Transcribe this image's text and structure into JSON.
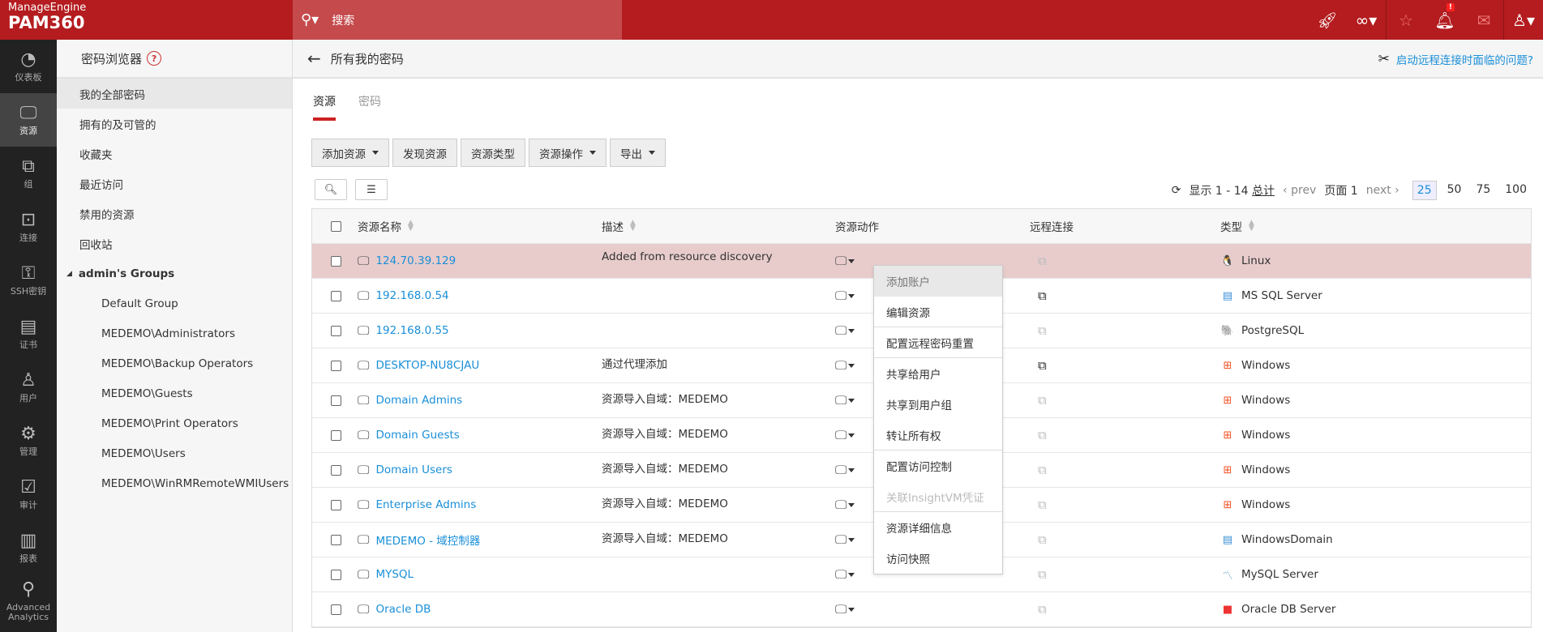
{
  "header": {
    "brand": "ManageEngine",
    "product": "PAM360",
    "search_placeholder": "搜索",
    "alert_badge": "!"
  },
  "iconbar": [
    {
      "label": "仪表板",
      "icon": "dashboard-icon",
      "glyph": "◔"
    },
    {
      "label": "资源",
      "icon": "monitor-icon",
      "glyph": "🖵",
      "active": true
    },
    {
      "label": "组",
      "icon": "group-icon",
      "glyph": "⧉"
    },
    {
      "label": "连接",
      "icon": "connection-icon",
      "glyph": "⊡"
    },
    {
      "label": "SSH密钥",
      "icon": "ssh-key-icon",
      "glyph": "⚿"
    },
    {
      "label": "证书",
      "icon": "certificate-icon",
      "glyph": "▤"
    },
    {
      "label": "用户",
      "icon": "user-icon",
      "glyph": "♙"
    },
    {
      "label": "管理",
      "icon": "gear-icon",
      "glyph": "⚙"
    },
    {
      "label": "审计",
      "icon": "clipboard-icon",
      "glyph": "☑"
    },
    {
      "label": "报表",
      "icon": "bar-chart-icon",
      "glyph": "▥"
    },
    {
      "label": "Advanced Analytics",
      "icon": "analytics-icon",
      "glyph": "⚲"
    }
  ],
  "sidebar": {
    "title": "密码浏览器",
    "help": "?",
    "items": [
      "我的全部密码",
      "拥有的及可管的",
      "收藏夹",
      "最近访问",
      "禁用的资源",
      "回收站"
    ],
    "group_title": "admin's Groups",
    "groups": [
      "Default Group",
      "MEDEMO\\Administrators",
      "MEDEMO\\Backup Operators",
      "MEDEMO\\Guests",
      "MEDEMO\\Print Operators",
      "MEDEMO\\Users",
      "MEDEMO\\WinRMRemoteWMIUsers"
    ]
  },
  "main": {
    "title": "所有我的密码",
    "issue_link": "启动远程连接时面临的问题?",
    "tabs": [
      "资源",
      "密码"
    ],
    "toolbar": [
      "添加资源",
      "发现资源",
      "资源类型",
      "资源操作",
      "导出"
    ],
    "pager": {
      "showing": "显示 1 - 14",
      "total": "总计",
      "prev": "prev",
      "page": "页面 1",
      "next": "next",
      "sizes": [
        "25",
        "50",
        "75",
        "100"
      ],
      "selected_size": "25"
    },
    "columns": [
      "资源名称",
      "描述",
      "资源动作",
      "远程连接",
      "类型"
    ],
    "rows": [
      {
        "name": "124.70.39.129",
        "desc": "Added from resource discovery",
        "remote": false,
        "type": "Linux",
        "ticon": "🐧",
        "tcolor": "#222"
      },
      {
        "name": "192.168.0.54",
        "desc": "",
        "remote": true,
        "type": "MS SQL Server",
        "ticon": "▤",
        "tcolor": "#3a8fd6"
      },
      {
        "name": "192.168.0.55",
        "desc": "",
        "remote": false,
        "type": "PostgreSQL",
        "ticon": "🐘",
        "tcolor": "#336791"
      },
      {
        "name": "DESKTOP-NU8CJAU",
        "desc": "通过代理添加",
        "remote": true,
        "type": "Windows",
        "ticon": "⊞",
        "tcolor": "#f25022"
      },
      {
        "name": "Domain Admins",
        "desc": "资源导入自域：MEDEMO",
        "remote": false,
        "type": "Windows",
        "ticon": "⊞",
        "tcolor": "#f25022"
      },
      {
        "name": "Domain Guests",
        "desc": "资源导入自域：MEDEMO",
        "remote": false,
        "type": "Windows",
        "ticon": "⊞",
        "tcolor": "#f25022"
      },
      {
        "name": "Domain Users",
        "desc": "资源导入自域：MEDEMO",
        "remote": false,
        "type": "Windows",
        "ticon": "⊞",
        "tcolor": "#f25022"
      },
      {
        "name": "Enterprise Admins",
        "desc": "资源导入自域：MEDEMO",
        "remote": false,
        "type": "Windows",
        "ticon": "⊞",
        "tcolor": "#f25022"
      },
      {
        "name": "MEDEMO - 域控制器",
        "desc": "资源导入自域：MEDEMO",
        "remote": false,
        "type": "WindowsDomain",
        "ticon": "▤",
        "tcolor": "#3a8fd6"
      },
      {
        "name": "MYSQL",
        "desc": "",
        "remote": false,
        "type": "MySQL Server",
        "ticon": "〽",
        "tcolor": "#5aa0c8"
      },
      {
        "name": "Oracle DB",
        "desc": "",
        "remote": false,
        "type": "Oracle DB Server",
        "ticon": "■",
        "tcolor": "#e33"
      }
    ],
    "menu": [
      {
        "label": "添加账户",
        "state": "hover"
      },
      {
        "label": "编辑资源",
        "sep": true
      },
      {
        "label": "配置远程密码重置",
        "sep": true
      },
      {
        "label": "共享给用户"
      },
      {
        "label": "共享到用户组"
      },
      {
        "label": "转让所有权",
        "sep": true
      },
      {
        "label": "配置访问控制"
      },
      {
        "label": "关联InsightVM凭证",
        "state": "dis",
        "sep": true
      },
      {
        "label": "资源详细信息"
      },
      {
        "label": "访问快照"
      }
    ]
  }
}
